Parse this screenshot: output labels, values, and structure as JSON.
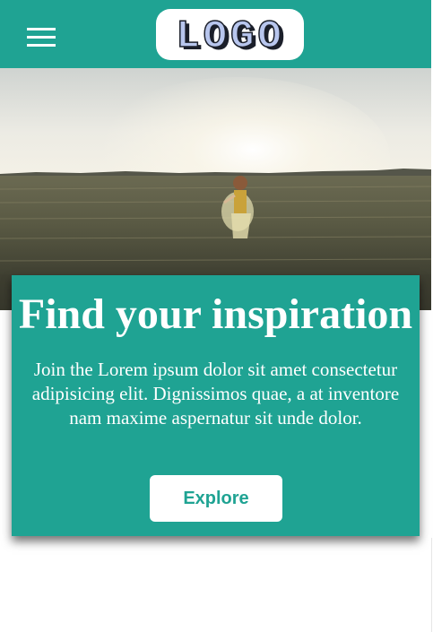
{
  "header": {
    "menu_icon": "hamburger-menu-icon",
    "logo_text": "LOGO",
    "background": "#1fa393"
  },
  "hero": {
    "image": "wheat-field-sunset-photo"
  },
  "panel": {
    "title": "Find your inspiration",
    "text": "Join the Lorem ipsum dolor sit amet consectetur adipisicing elit. Dignissimos quae, a at inventore nam maxime aspernatur sit unde dolor.",
    "button_label": "Explore",
    "background": "#1fa393"
  }
}
